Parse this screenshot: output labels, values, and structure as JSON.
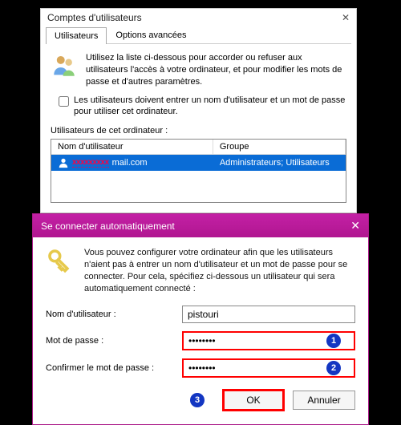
{
  "main_window": {
    "title": "Comptes d'utilisateurs",
    "tabs": {
      "users": "Utilisateurs",
      "advanced": "Options avancées"
    },
    "intro": "Utilisez la liste ci-dessous pour accorder ou refuser aux utilisateurs l'accès à votre ordinateur, et pour modifier les mots de passe et d'autres paramètres.",
    "checkbox_label": "Les utilisateurs doivent entrer un nom d'utilisateur et un mot de passe pour utiliser cet ordinateur.",
    "list_label": "Utilisateurs de cet ordinateur :",
    "columns": {
      "name": "Nom d'utilisateur",
      "group": "Groupe"
    },
    "row": {
      "redacted": "xxxxxxxxx",
      "mail_rest": "mail.com",
      "group": "Administrateurs; Utilisateurs"
    }
  },
  "dialog": {
    "title": "Se connecter automatiquement",
    "intro": "Vous pouvez configurer votre ordinateur afin que les utilisateurs n'aient pas à entrer un nom d'utilisateur et un mot de passe pour se connecter. Pour cela, spécifiez ci-dessous un utilisateur qui sera automatiquement connecté :",
    "labels": {
      "username": "Nom d'utilisateur :",
      "password": "Mot de passe :",
      "confirm": "Confirmer le mot de passe :"
    },
    "values": {
      "username": "pistouri",
      "password": "••••••••",
      "confirm": "••••••••"
    },
    "buttons": {
      "ok": "OK",
      "cancel": "Annuler"
    },
    "badges": {
      "b1": "1",
      "b2": "2",
      "b3": "3"
    }
  }
}
